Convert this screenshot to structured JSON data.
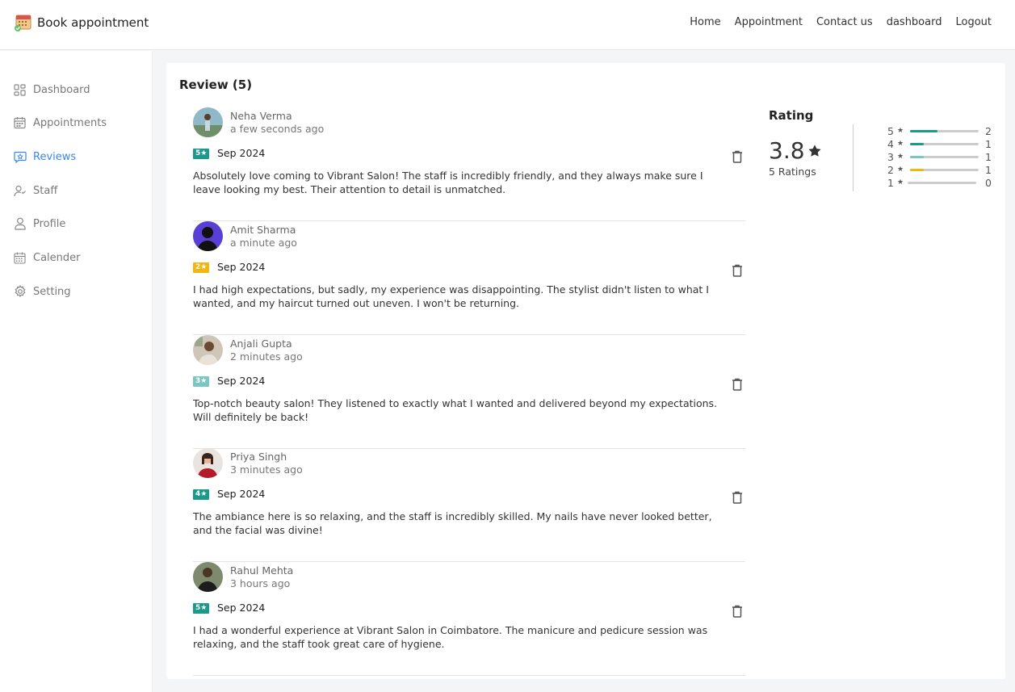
{
  "navbar": {
    "brand": "Book appointment",
    "links": [
      "Home",
      "Appointment",
      "Contact us",
      "dashboard",
      "Logout"
    ]
  },
  "sidebar": {
    "items": [
      {
        "label": "Dashboard",
        "icon": "dashboard-icon"
      },
      {
        "label": "Appointments",
        "icon": "calendar-icon"
      },
      {
        "label": "Reviews",
        "icon": "review-icon",
        "active": true
      },
      {
        "label": "Staff",
        "icon": "staff-icon"
      },
      {
        "label": "Profile",
        "icon": "profile-icon"
      },
      {
        "label": "Calender",
        "icon": "calendar-grid-icon"
      },
      {
        "label": "Setting",
        "icon": "gear-icon"
      }
    ]
  },
  "reviews": {
    "title": "Review (5)",
    "items": [
      {
        "name": "Neha Verma",
        "time": "a few seconds ago",
        "rating": "5★",
        "date": "Sep 2024",
        "text": "Absolutely love coming to Vibrant Salon! The staff is incredibly friendly, and they always make sure I leave looking my best. Their attention to detail is unmatched.",
        "badge_color": "#1a9a8a"
      },
      {
        "name": "Amit Sharma",
        "time": "a minute ago",
        "rating": "2★",
        "date": "Sep 2024",
        "text": "I had high expectations, but sadly, my experience was disappointing. The stylist didn't listen to what I wanted, and my haircut turned out uneven. I won't be returning.",
        "badge_color": "#f5b40f"
      },
      {
        "name": "Anjali Gupta",
        "time": "2 minutes ago",
        "rating": "3★",
        "date": "Sep 2024",
        "text": "Top-notch beauty salon! They listened to exactly what I wanted and delivered beyond my expectations. Will definitely be back!",
        "badge_color": "#7ac6c2"
      },
      {
        "name": "Priya Singh",
        "time": "3 minutes ago",
        "rating": "4★",
        "date": "Sep 2024",
        "text": "The ambiance here is so relaxing, and the staff is incredibly skilled. My nails have never looked better, and the facial was divine!",
        "badge_color": "#1a9a8a"
      },
      {
        "name": "Rahul Mehta",
        "time": "3 hours ago",
        "rating": "5★",
        "date": "Sep 2024",
        "text": "I had a wonderful experience at Vibrant Salon in Coimbatore. The manicure and pedicure session was relaxing, and the staff took great care of hygiene.",
        "badge_color": "#1a9a8a"
      }
    ]
  },
  "rating": {
    "title": "Rating",
    "value": "3.8",
    "count_label": "5 Ratings",
    "distribution": [
      {
        "stars": "5",
        "count": "2",
        "fraction": 0.4,
        "color": "#1a9a8a"
      },
      {
        "stars": "4",
        "count": "1",
        "fraction": 0.2,
        "color": "#1a9a8a"
      },
      {
        "stars": "3",
        "count": "1",
        "fraction": 0.2,
        "color": "#7ac6c2"
      },
      {
        "stars": "2",
        "count": "1",
        "fraction": 0.2,
        "color": "#f5b40f"
      },
      {
        "stars": "1",
        "count": "0",
        "fraction": 0,
        "color": "#1a9a8a"
      }
    ]
  }
}
